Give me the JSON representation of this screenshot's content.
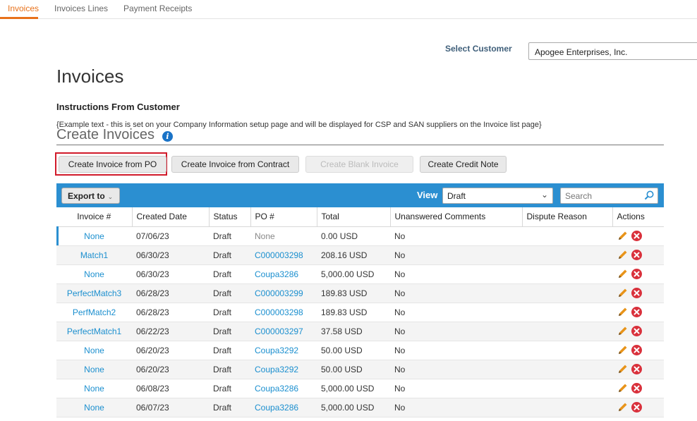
{
  "tabs": [
    {
      "label": "Invoices",
      "active": true
    },
    {
      "label": "Invoices Lines",
      "active": false
    },
    {
      "label": "Payment Receipts",
      "active": false
    }
  ],
  "customer": {
    "label": "Select Customer",
    "value": "Apogee Enterprises, Inc."
  },
  "page_title": "Invoices",
  "instructions": {
    "title": "Instructions From Customer",
    "text": "{Example text - this is set on your Company Information setup page and will be displayed for CSP and SAN suppliers on the Invoice list page}"
  },
  "create_section": {
    "title": "Create Invoices",
    "info_glyph": "i"
  },
  "buttons": {
    "from_po": "Create Invoice from PO",
    "from_contract": "Create Invoice from Contract",
    "blank": "Create Blank Invoice",
    "credit_note": "Create Credit Note"
  },
  "toolbar": {
    "export_label": "Export to",
    "view_label": "View",
    "view_value": "Draft",
    "search_placeholder": "Search"
  },
  "columns": [
    "Invoice #",
    "Created Date",
    "Status",
    "PO #",
    "Total",
    "Unanswered Comments",
    "Dispute Reason",
    "Actions"
  ],
  "rows": [
    {
      "invoice": "None",
      "date": "07/06/23",
      "status": "Draft",
      "po": "None",
      "total": "0.00 USD",
      "comments": "No",
      "dispute": ""
    },
    {
      "invoice": "Match1",
      "date": "06/30/23",
      "status": "Draft",
      "po": "C000003298",
      "total": "208.16 USD",
      "comments": "No",
      "dispute": ""
    },
    {
      "invoice": "None",
      "date": "06/30/23",
      "status": "Draft",
      "po": "Coupa3286",
      "total": "5,000.00 USD",
      "comments": "No",
      "dispute": ""
    },
    {
      "invoice": "PerfectMatch3",
      "date": "06/28/23",
      "status": "Draft",
      "po": "C000003299",
      "total": "189.83 USD",
      "comments": "No",
      "dispute": ""
    },
    {
      "invoice": "PerfMatch2",
      "date": "06/28/23",
      "status": "Draft",
      "po": "C000003298",
      "total": "189.83 USD",
      "comments": "No",
      "dispute": ""
    },
    {
      "invoice": "PerfectMatch1",
      "date": "06/22/23",
      "status": "Draft",
      "po": "C000003297",
      "total": "37.58 USD",
      "comments": "No",
      "dispute": ""
    },
    {
      "invoice": "None",
      "date": "06/20/23",
      "status": "Draft",
      "po": "Coupa3292",
      "total": "50.00 USD",
      "comments": "No",
      "dispute": ""
    },
    {
      "invoice": "None",
      "date": "06/20/23",
      "status": "Draft",
      "po": "Coupa3292",
      "total": "50.00 USD",
      "comments": "No",
      "dispute": ""
    },
    {
      "invoice": "None",
      "date": "06/08/23",
      "status": "Draft",
      "po": "Coupa3286",
      "total": "5,000.00 USD",
      "comments": "No",
      "dispute": ""
    },
    {
      "invoice": "None",
      "date": "06/07/23",
      "status": "Draft",
      "po": "Coupa3286",
      "total": "5,000.00 USD",
      "comments": "No",
      "dispute": ""
    }
  ],
  "colors": {
    "accent": "#e8711a",
    "toolbar": "#2b8fd1",
    "link": "#1b8fcf",
    "delete": "#d9303b",
    "edit": "#e8941a"
  }
}
